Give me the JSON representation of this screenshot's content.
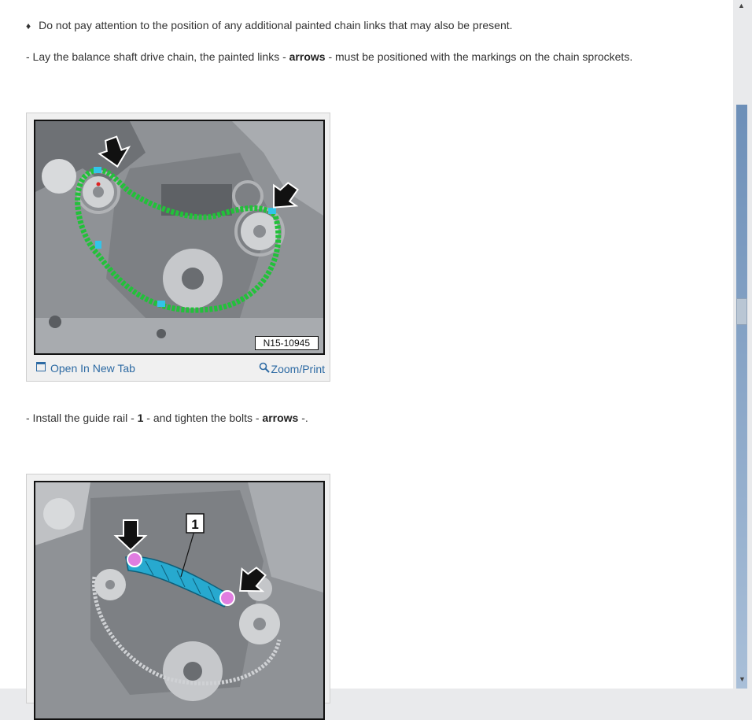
{
  "content": {
    "bullet_text": "Do not pay attention to the position of any additional painted chain links that may also be present.",
    "step1": {
      "prefix": "-  Lay the balance shaft drive chain, the painted links - ",
      "bold": "arrows",
      "suffix": " - must be positioned with the markings on the chain sprockets."
    },
    "figure1": {
      "label": "N15-10945",
      "open_link": "Open In New Tab",
      "zoom_link": "Zoom/Print"
    },
    "step2": {
      "prefix": "-  Install the guide rail - ",
      "bold1": "1",
      "middle": " - and tighten the bolts - ",
      "bold2": "arrows",
      "suffix": " -."
    },
    "figure2": {
      "callout": "1"
    }
  },
  "icons": {
    "bullet": "diamond-bullet",
    "open": "open-new-tab-icon",
    "zoom": "magnifier-icon"
  },
  "colors": {
    "link": "#2d6aa3",
    "chain_highlight": "#22c13a",
    "guide_rail": "#27a9cf",
    "bolt_marker": "#e07de0"
  }
}
